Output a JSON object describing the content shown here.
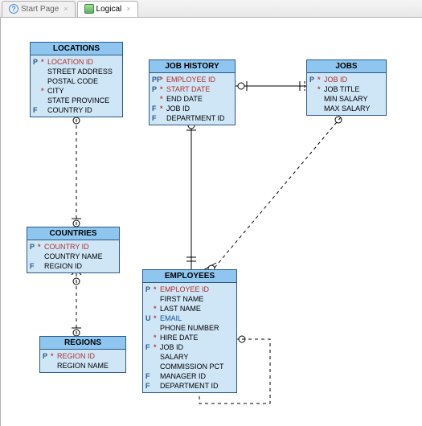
{
  "tabs": {
    "start": "Start Page",
    "logical": "Logical"
  },
  "entities": {
    "locations": {
      "title": "LOCATIONS",
      "attrs": [
        {
          "k1": "P",
          "k2": "*",
          "name": "LOCATION ID",
          "cls": "red"
        },
        {
          "k1": "",
          "k2": "",
          "name": "STREET ADDRESS",
          "cls": ""
        },
        {
          "k1": "",
          "k2": "",
          "name": "POSTAL CODE",
          "cls": ""
        },
        {
          "k1": "",
          "k2": "*",
          "name": "CITY",
          "cls": ""
        },
        {
          "k1": "",
          "k2": "",
          "name": "STATE PROVINCE",
          "cls": ""
        },
        {
          "k1": "F",
          "k2": "",
          "name": "COUNTRY ID",
          "cls": ""
        }
      ]
    },
    "job_history": {
      "title": "JOB HISTORY",
      "attrs": [
        {
          "k1": "PF",
          "k2": "*",
          "name": "EMPLOYEE ID",
          "cls": "red"
        },
        {
          "k1": "P",
          "k2": "*",
          "name": "START DATE",
          "cls": "red"
        },
        {
          "k1": "",
          "k2": "*",
          "name": "END DATE",
          "cls": ""
        },
        {
          "k1": "F",
          "k2": "*",
          "name": "JOB ID",
          "cls": ""
        },
        {
          "k1": "F",
          "k2": "",
          "name": "DEPARTMENT ID",
          "cls": ""
        }
      ]
    },
    "jobs": {
      "title": "JOBS",
      "attrs": [
        {
          "k1": "P",
          "k2": "*",
          "name": "JOB ID",
          "cls": "red"
        },
        {
          "k1": "",
          "k2": "*",
          "name": "JOB TITLE",
          "cls": ""
        },
        {
          "k1": "",
          "k2": "",
          "name": "MIN SALARY",
          "cls": ""
        },
        {
          "k1": "",
          "k2": "",
          "name": "MAX SALARY",
          "cls": ""
        }
      ]
    },
    "countries": {
      "title": "COUNTRIES",
      "attrs": [
        {
          "k1": "P",
          "k2": "*",
          "name": "COUNTRY ID",
          "cls": "red"
        },
        {
          "k1": "",
          "k2": "",
          "name": "COUNTRY NAME",
          "cls": ""
        },
        {
          "k1": "F",
          "k2": "",
          "name": "REGION ID",
          "cls": ""
        }
      ]
    },
    "employees": {
      "title": "EMPLOYEES",
      "attrs": [
        {
          "k1": "P",
          "k2": "*",
          "name": "EMPLOYEE ID",
          "cls": "red"
        },
        {
          "k1": "",
          "k2": "",
          "name": "FIRST NAME",
          "cls": ""
        },
        {
          "k1": "",
          "k2": "*",
          "name": "LAST NAME",
          "cls": ""
        },
        {
          "k1": "U",
          "k2": "*",
          "name": "EMAIL",
          "cls": "blue"
        },
        {
          "k1": "",
          "k2": "",
          "name": "PHONE NUMBER",
          "cls": ""
        },
        {
          "k1": "",
          "k2": "*",
          "name": "HIRE DATE",
          "cls": ""
        },
        {
          "k1": "F",
          "k2": "*",
          "name": "JOB ID",
          "cls": ""
        },
        {
          "k1": "",
          "k2": "",
          "name": "SALARY",
          "cls": ""
        },
        {
          "k1": "",
          "k2": "",
          "name": "COMMISSION PCT",
          "cls": ""
        },
        {
          "k1": "F",
          "k2": "",
          "name": "MANAGER ID",
          "cls": ""
        },
        {
          "k1": "F",
          "k2": "",
          "name": "DEPARTMENT ID",
          "cls": ""
        }
      ]
    },
    "regions": {
      "title": "REGIONS",
      "attrs": [
        {
          "k1": "P",
          "k2": "*",
          "name": "REGION ID",
          "cls": "red"
        },
        {
          "k1": "",
          "k2": "",
          "name": "REGION NAME",
          "cls": ""
        }
      ]
    }
  }
}
